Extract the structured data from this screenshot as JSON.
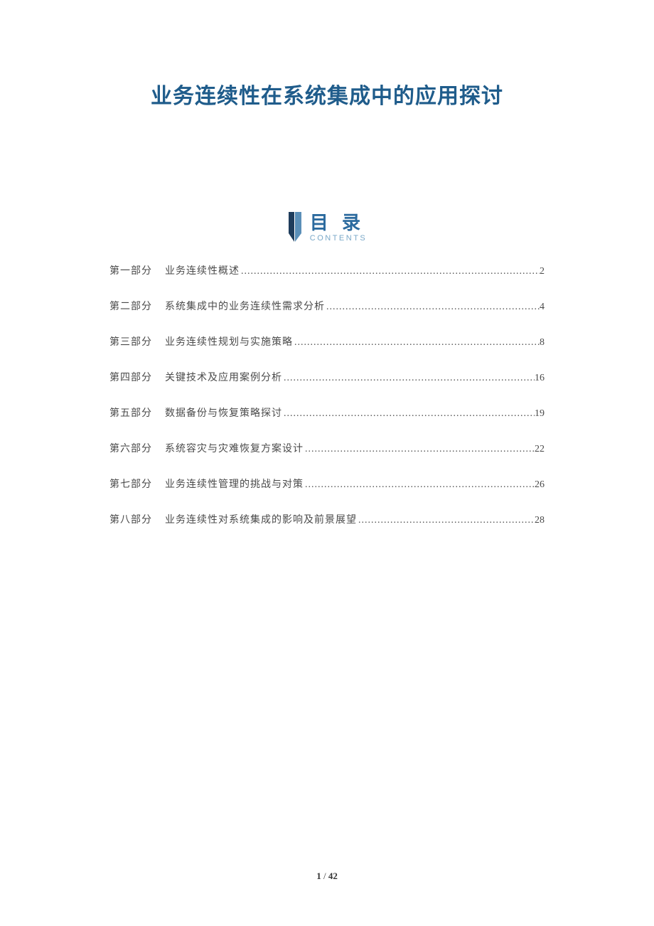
{
  "title": "业务连续性在系统集成中的应用探讨",
  "toc_header": {
    "cn": "目 录",
    "en": "CONTENTS"
  },
  "toc": [
    {
      "part": "第一部分",
      "title": "业务连续性概述",
      "page": "2"
    },
    {
      "part": "第二部分",
      "title": "系统集成中的业务连续性需求分析",
      "page": "4"
    },
    {
      "part": "第三部分",
      "title": "业务连续性规划与实施策略",
      "page": "8"
    },
    {
      "part": "第四部分",
      "title": "关键技术及应用案例分析",
      "page": "16"
    },
    {
      "part": "第五部分",
      "title": "数据备份与恢复策略探讨",
      "page": "19"
    },
    {
      "part": "第六部分",
      "title": "系统容灾与灾难恢复方案设计",
      "page": "22"
    },
    {
      "part": "第七部分",
      "title": "业务连续性管理的挑战与对策",
      "page": "26"
    },
    {
      "part": "第八部分",
      "title": "业务连续性对系统集成的影响及前景展望",
      "page": "28"
    }
  ],
  "footer": {
    "current": "1",
    "sep": " / ",
    "total": "42"
  }
}
